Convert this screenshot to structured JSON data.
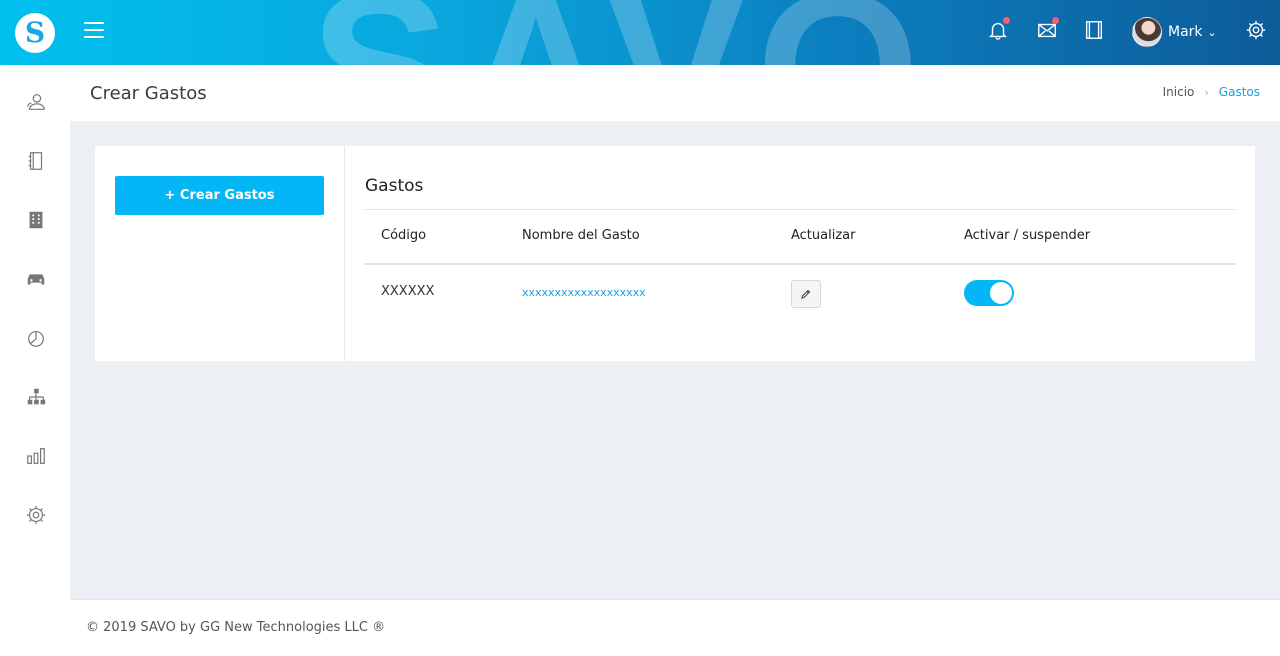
{
  "brand": {
    "logo_letter": "S",
    "watermark": "SAVO"
  },
  "topbar": {
    "icons": [
      "menu-icon",
      "bell-icon",
      "mail-icon",
      "film-icon",
      "gear-icon"
    ],
    "user": {
      "name": "Mark"
    },
    "notification_color": "#ff5a6e"
  },
  "sidebar": {
    "items": [
      "users-icon",
      "notebook-icon",
      "building-icon",
      "car-icon",
      "pie-chart-icon",
      "org-chart-icon",
      "bar-chart-icon",
      "settings-icon"
    ]
  },
  "header": {
    "title": "Crear Gastos",
    "breadcrumb": {
      "home": "Inicio",
      "current": "Gastos"
    }
  },
  "card": {
    "create_button": "+ Crear Gastos",
    "section_title": "Gastos",
    "columns": [
      "Código",
      "Nombre del Gasto",
      "Actualizar",
      "Activar / suspender"
    ],
    "rows": [
      {
        "code": "XXXXXX",
        "name": "xxxxxxxxxxxxxxxxxxx",
        "active": true
      }
    ]
  },
  "footer": {
    "text": "© 2019 SAVO by GG New Technologies LLC ®"
  },
  "colors": {
    "accent": "#04b6f5",
    "link": "#1ba0df"
  }
}
